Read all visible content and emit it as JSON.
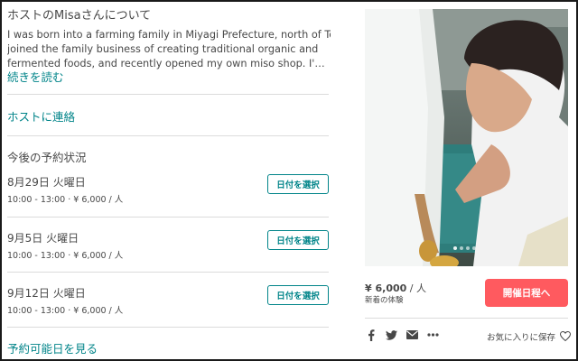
{
  "host": {
    "title": "ホストのMisaさんについて",
    "bio_lines": [
      "I was born into a farming family in Miyagi Prefecture, north of Tokyo. I",
      "joined the family business of creating traditional organic and",
      "fermented foods, and recently opened my own miso shop. I'm passi..."
    ],
    "read_more": "続きを読む",
    "contact": "ホストに連絡"
  },
  "availability": {
    "title": "今後の予約状況",
    "rows": [
      {
        "date": "8月29日 火曜日",
        "meta": "10:00 - 13:00 · ¥ 6,000 / 人",
        "button": "日付を選択"
      },
      {
        "date": "9月5日 火曜日",
        "meta": "10:00 - 13:00 · ¥ 6,000 / 人",
        "button": "日付を選択"
      },
      {
        "date": "9月12日 火曜日",
        "meta": "10:00 - 13:00 · ¥ 6,000 / 人",
        "button": "日付を選択"
      }
    ],
    "see_all": "予約可能日を見る"
  },
  "booking": {
    "price": "¥ 6,000",
    "price_unit": " / 人",
    "badge": "新着の体験",
    "cta": "開催日程へ",
    "save": "お気に入りに保存"
  },
  "share_icons": [
    "facebook-icon",
    "twitter-icon",
    "email-icon",
    "more-icon"
  ],
  "colors": {
    "accent": "#008489",
    "cta": "#ff5a5f",
    "text": "#484848"
  }
}
